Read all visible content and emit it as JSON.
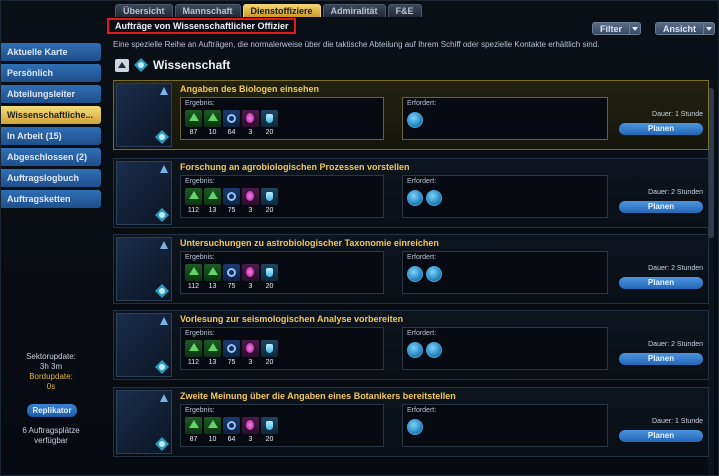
{
  "tabs": [
    {
      "label": "Übersicht"
    },
    {
      "label": "Mannschaft"
    },
    {
      "label": "Dienstoffiziere"
    },
    {
      "label": "Admiralität"
    },
    {
      "label": "F&E"
    }
  ],
  "sidebar": {
    "items": [
      {
        "label": "Aktuelle Karte"
      },
      {
        "label": "Persönlich"
      },
      {
        "label": "Abteilungsleiter"
      },
      {
        "label": "Wissenschaftliche..."
      },
      {
        "label": "In Arbeit (15)"
      },
      {
        "label": "Abgeschlossen (2)"
      },
      {
        "label": "Auftragslogbuch"
      },
      {
        "label": "Auftragsketten"
      }
    ],
    "sector_update_label": "Sektorupdate:",
    "sector_update_value": "3h 3m",
    "board_update_label": "Bordupdate:",
    "board_update_value": "0s",
    "replikator_label": "Replikator",
    "slots_text_1": "6 Auftragsplätze",
    "slots_text_2": "verfügbar"
  },
  "main": {
    "title": "Aufträge von Wissenschaftlicher Offizier",
    "subtitle": "Eine spezielle Reihe an Aufträgen, die normalerweise über die taktische Abteilung auf Ihrem Schiff oder spezielle Kontakte erhältlich sind.",
    "filter_label": "Filter",
    "view_label": "Ansicht",
    "section_title": "Wissenschaft",
    "result_label": "Ergebnis:",
    "required_label": "Erfordert:",
    "plan_label": "Planen"
  },
  "missions": [
    {
      "title": "Angaben des Biologen einsehen",
      "results": [
        "87",
        "10",
        "64",
        "3",
        "20"
      ],
      "duration": "Dauer: 1 Stunde",
      "required_count": 1
    },
    {
      "title": "Forschung an agrobiologischen Prozessen vorstellen",
      "results": [
        "112",
        "13",
        "75",
        "3",
        "20"
      ],
      "duration": "Dauer: 2 Stunden",
      "required_count": 2
    },
    {
      "title": "Untersuchungen zu astrobiologischer Taxonomie einreichen",
      "results": [
        "112",
        "13",
        "75",
        "3",
        "20"
      ],
      "duration": "Dauer: 2 Stunden",
      "required_count": 2
    },
    {
      "title": "Vorlesung zur seismologischen Analyse vorbereiten",
      "results": [
        "112",
        "13",
        "75",
        "3",
        "20"
      ],
      "duration": "Dauer: 2 Stunden",
      "required_count": 2
    },
    {
      "title": "Zweite Meinung über die Angaben eines Botanikers bereitstellen",
      "results": [
        "87",
        "10",
        "64",
        "3",
        "20"
      ],
      "duration": "Dauer: 1 Stunde",
      "required_count": 1
    }
  ],
  "result_icon_types": [
    "up-arrow-icon",
    "up-arrow-icon",
    "dilithium-icon",
    "gem-icon",
    "flask-icon"
  ]
}
